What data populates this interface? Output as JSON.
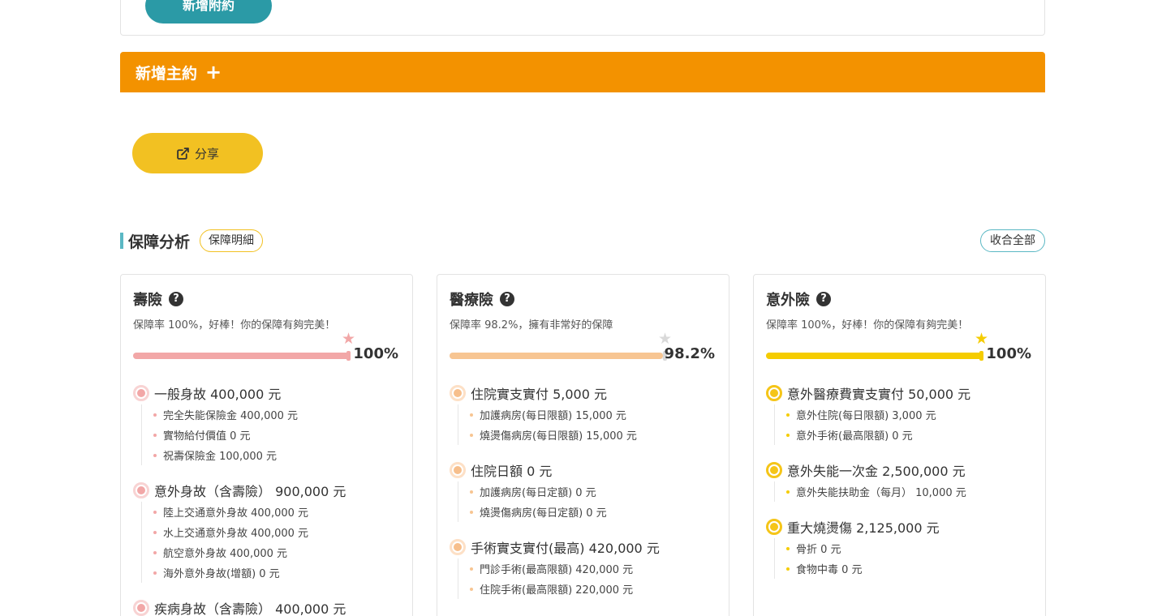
{
  "rider": {
    "add_label": "新增附約"
  },
  "main_add": {
    "label": "新增主約",
    "icon": "plus-icon"
  },
  "share": {
    "label": "分享",
    "icon": "external-link-icon"
  },
  "section": {
    "title": "保障分析",
    "detail_label": "保障明細",
    "collapse_label": "收合全部",
    "accent": "#5bb8c4"
  },
  "cards": [
    {
      "title": "壽險",
      "desc": "保障率 100%，好棒！你的保障有夠完美！",
      "percent_label": "100%",
      "percent": 100,
      "color": "#f2a7a7",
      "groups": [
        {
          "head": "一般身故 400,000 元",
          "items": [
            "完全失能保險金 400,000 元",
            "實物給付價值 0 元",
            "祝壽保險金 100,000 元"
          ]
        },
        {
          "head": "意外身故（含壽險） 900,000 元",
          "items": [
            "陸上交通意外身故 400,000 元",
            "水上交通意外身故 400,000 元",
            "航空意外身故 400,000 元",
            "海外意外身故(增額) 0 元"
          ]
        },
        {
          "head": "疾病身故（含壽險） 400,000 元",
          "items": []
        }
      ]
    },
    {
      "title": "醫療險",
      "desc": "保障率 98.2%，擁有非常好的保障",
      "percent_label": "98.2%",
      "percent": 98.2,
      "color": "#f7c592",
      "groups": [
        {
          "head": "住院實支實付 5,000 元",
          "items": [
            "加護病房(每日限額) 15,000 元",
            "燒燙傷病房(每日限額) 15,000 元"
          ]
        },
        {
          "head": "住院日額 0 元",
          "items": [
            "加護病房(每日定額) 0 元",
            "燒燙傷病房(每日定額) 0 元"
          ]
        },
        {
          "head": "手術實支實付(最高) 420,000 元",
          "items": [
            "門診手術(最高限額) 420,000 元",
            "住院手術(最高限額) 220,000 元"
          ]
        }
      ]
    },
    {
      "title": "意外險",
      "desc": "保障率 100%，好棒！你的保障有夠完美！",
      "percent_label": "100%",
      "percent": 100,
      "color": "#f5cc00",
      "groups": [
        {
          "head": "意外醫療費實支實付 50,000 元",
          "items": [
            "意外住院(每日限額) 3,000 元",
            "意外手術(最高限額) 0 元"
          ]
        },
        {
          "head": "意外失能一次金 2,500,000 元",
          "items": [
            "意外失能扶助金（每月） 10,000 元"
          ]
        },
        {
          "head": "重大燒燙傷 2,125,000 元",
          "items": [
            "骨折 0 元",
            "食物中毒 0 元"
          ]
        }
      ]
    }
  ]
}
